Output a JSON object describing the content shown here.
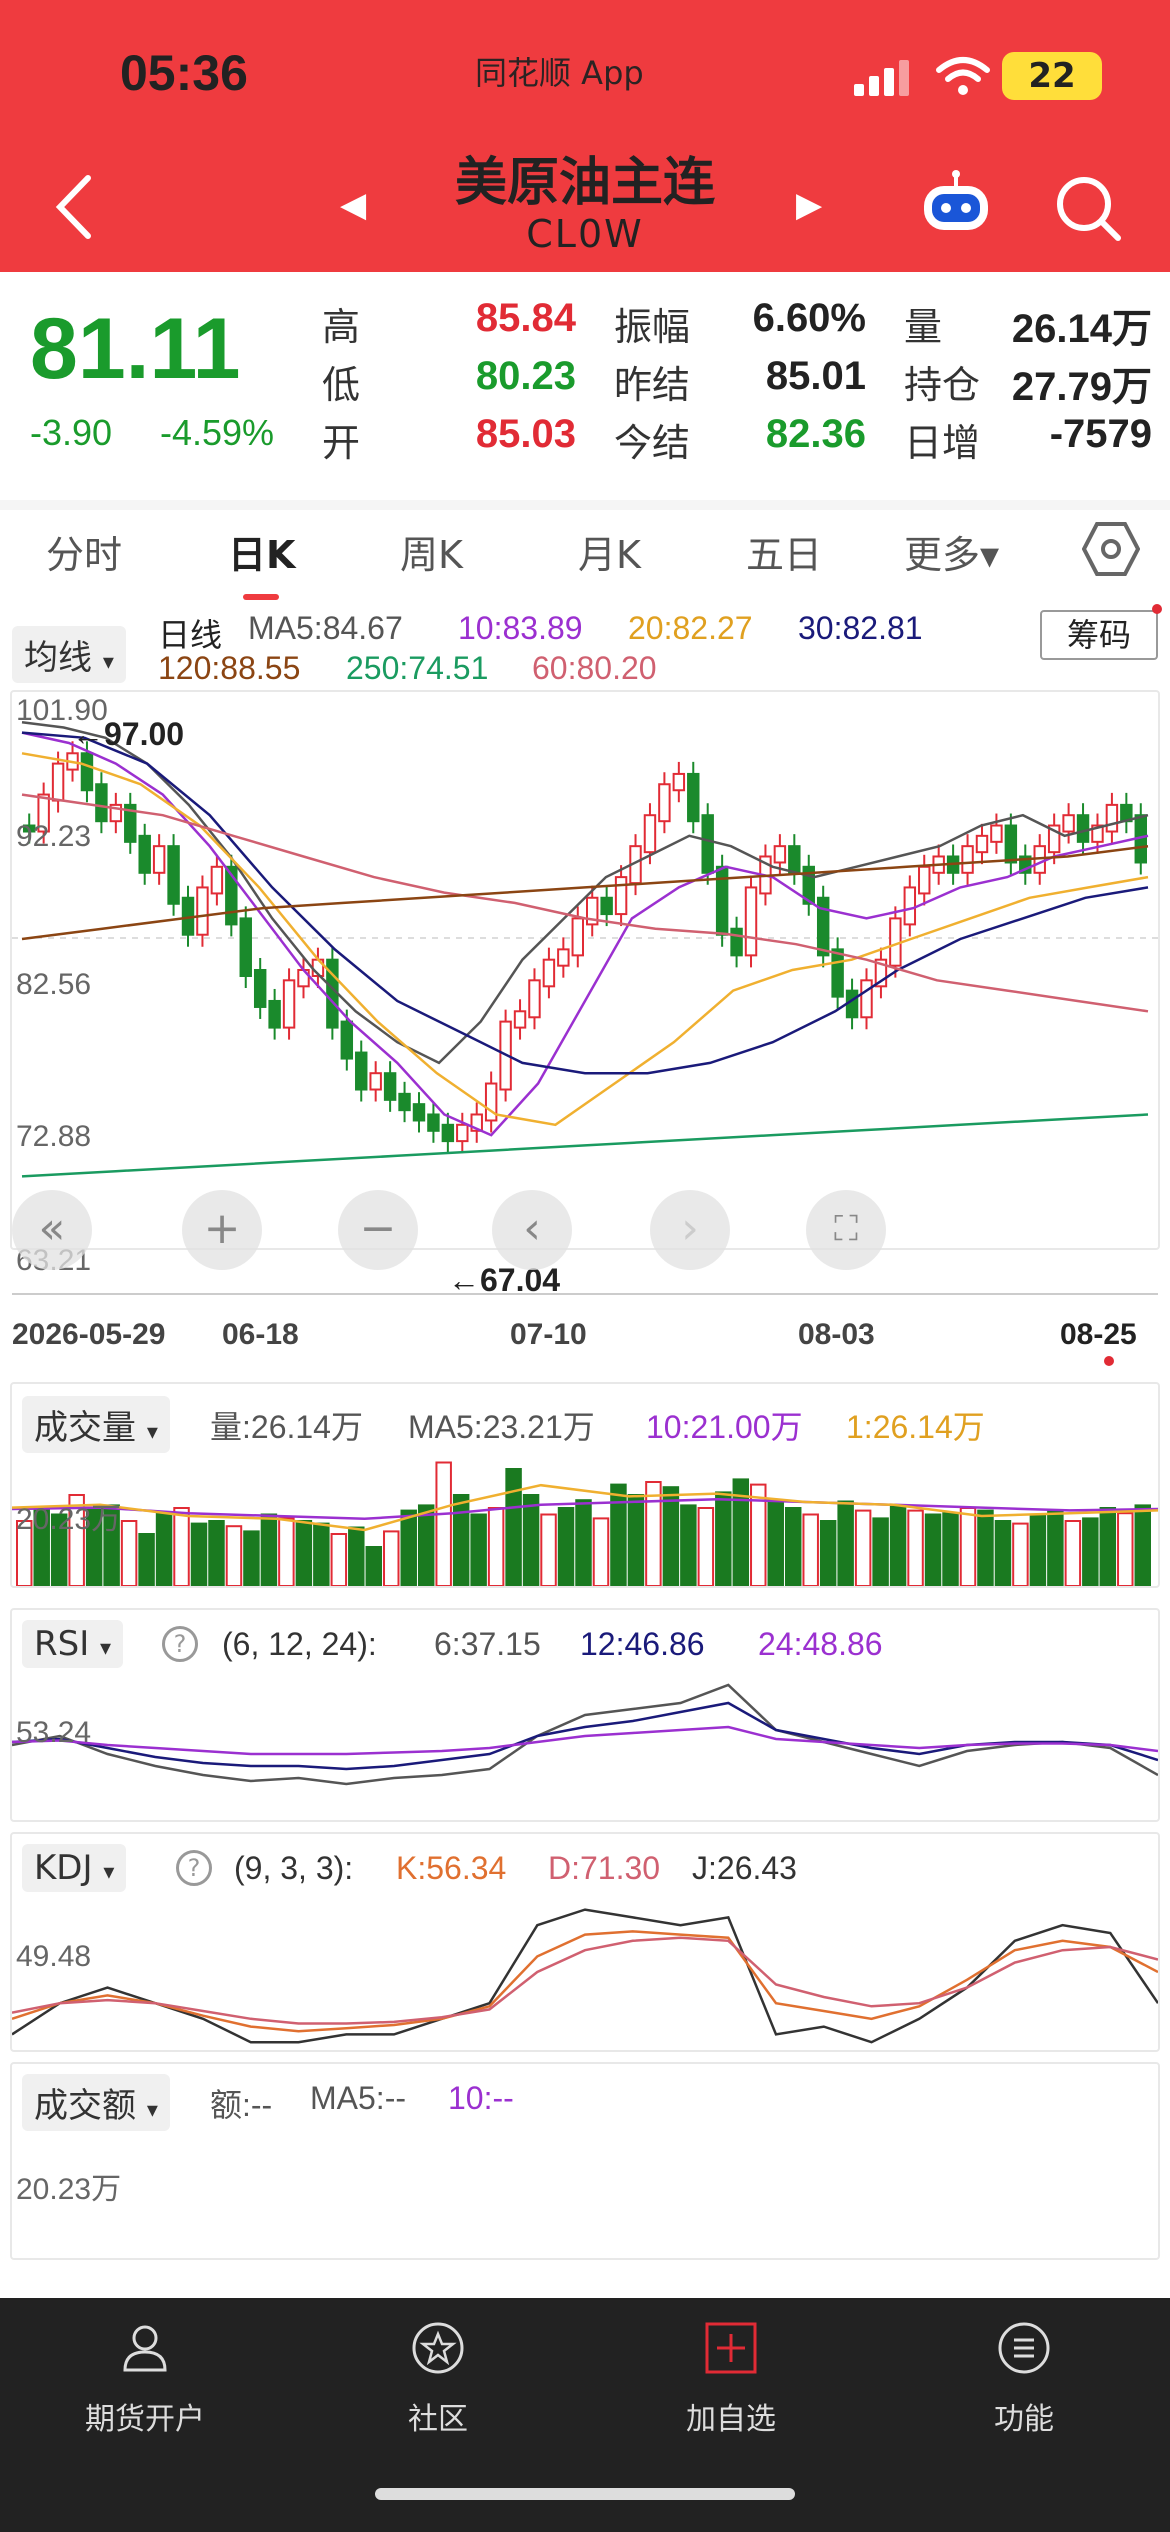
{
  "status_bar": {
    "time": "05:36",
    "app_name": "同花顺 App",
    "battery": "22"
  },
  "header": {
    "title": "美原油主连",
    "code": "CL0W"
  },
  "quote": {
    "price": "81.11",
    "change": "-3.90",
    "change_pct": "-4.59%",
    "rows": [
      {
        "l1": "高",
        "v1": "85.84",
        "c1": "red",
        "l2": "振幅",
        "v2": "6.60%",
        "c2": "black",
        "l3": "量",
        "v3": "26.14万",
        "c3": "black"
      },
      {
        "l1": "低",
        "v1": "80.23",
        "c1": "green",
        "l2": "昨结",
        "v2": "85.01",
        "c2": "black",
        "l3": "持仓",
        "v3": "27.79万",
        "c3": "black"
      },
      {
        "l1": "开",
        "v1": "85.03",
        "c1": "red",
        "l2": "今结",
        "v2": "82.36",
        "c2": "green",
        "l3": "日增",
        "v3": "-7579",
        "c3": "black"
      }
    ]
  },
  "tabs": [
    "分时",
    "日K",
    "周K",
    "月K",
    "五日",
    "更多▾"
  ],
  "ma_panel": {
    "select": "均线",
    "daily": "日线",
    "ma5": "MA5:84.67",
    "ma10": "10:83.89",
    "ma20": "20:82.27",
    "ma30": "30:82.81",
    "ma120": "120:88.55",
    "ma250": "250:74.51",
    "ma60": "60:80.20",
    "chip_button": "筹码",
    "y_labels": [
      "101.90",
      "92.23",
      "82.56",
      "72.88",
      "63.21"
    ],
    "high_mark": "←97.00",
    "low_mark": "←67.04",
    "dates": [
      "2026-05-29",
      "06-18",
      "07-10",
      "08-03",
      "08-25"
    ]
  },
  "volume_panel": {
    "select": "成交量",
    "vol": "量:26.14万",
    "ma5": "MA5:23.21万",
    "ma10": "10:21.00万",
    "ma1": "1:26.14万",
    "y_label": "20.23万"
  },
  "rsi_panel": {
    "select": "RSI",
    "params": "(6, 12, 24):",
    "r6": "6:37.15",
    "r12": "12:46.86",
    "r24": "24:48.86",
    "y_label": "53.24"
  },
  "kdj_panel": {
    "select": "KDJ",
    "params": "(9, 3, 3):",
    "k": "K:56.34",
    "d": "D:71.30",
    "j": "J:26.43",
    "y_label": "49.48"
  },
  "amount_panel": {
    "select": "成交额",
    "amt": "额:--",
    "ma5": "MA5:--",
    "ma10": "10:--",
    "y_label": "20.23万"
  },
  "tabbar": {
    "items": [
      "期货开户",
      "社区",
      "加自选",
      "功能"
    ]
  },
  "colors": {
    "header_red": "#ef3b3f",
    "up_red": "#e12b35",
    "down_green": "#1a9b2c",
    "ma5": "#555555",
    "ma10": "#9b30d0",
    "ma20": "#f0b030",
    "ma30": "#1a1a7a",
    "ma120": "#8b4513",
    "ma250": "#1a9b60",
    "ma60": "#d06070"
  }
}
